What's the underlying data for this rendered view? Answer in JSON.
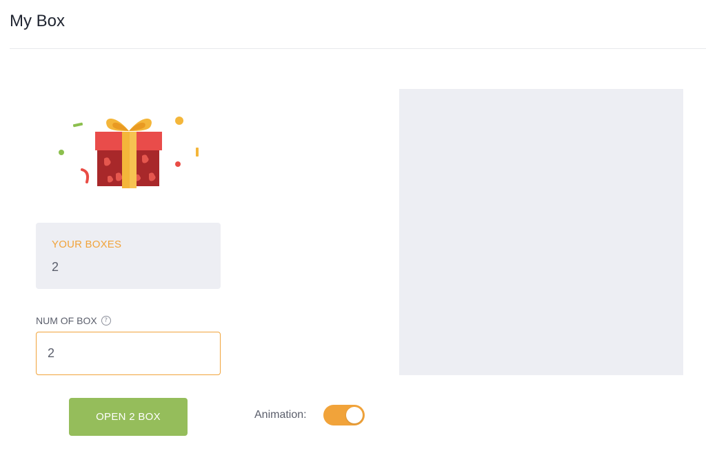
{
  "header": {
    "title": "My Box"
  },
  "illustration": {
    "icon": "gift-box-icon"
  },
  "boxes_card": {
    "label": "YOUR BOXES",
    "value": "2"
  },
  "num_of_box": {
    "label": "NUM OF BOX",
    "help_icon": "question-circle-icon",
    "value": "2"
  },
  "open_button": {
    "label": "OPEN 2 BOX"
  },
  "animation": {
    "label": "Animation:",
    "enabled": true
  },
  "colors": {
    "accent": "#f1a33a",
    "button_green": "#95bd5b",
    "panel_gray": "#edeef3"
  }
}
